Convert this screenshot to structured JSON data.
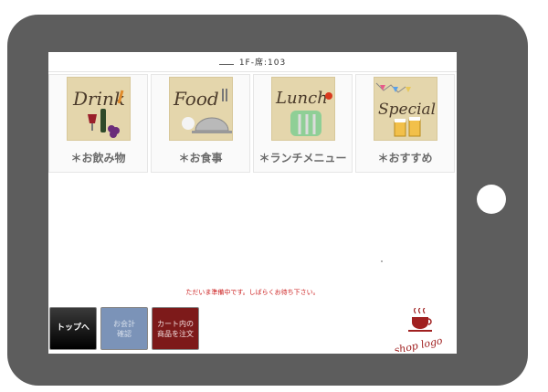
{
  "header": {
    "seat": "1F-席:103"
  },
  "categories": [
    {
      "label": "＊お飲み物",
      "image_word": "Drink",
      "icon": "drink-image"
    },
    {
      "label": "＊お食事",
      "image_word": "Food",
      "icon": "food-image"
    },
    {
      "label": "＊ランチメニュー",
      "image_word": "Lunch",
      "icon": "lunch-image"
    },
    {
      "label": "＊おすすめ",
      "image_word": "Special",
      "icon": "special-image"
    }
  ],
  "notice": "ただいま準備中です。しばらくお待ち下さい。",
  "buttons": {
    "top": "トップへ",
    "bill_line1": "お会計",
    "bill_line2": "確認",
    "order_line1": "カート内の",
    "order_line2": "商品を注文"
  },
  "logo": {
    "text": "shop logo"
  },
  "colors": {
    "frame": "#5d5d5d",
    "notice": "#cc2020",
    "bill": "#7b93b8",
    "order": "#7d1a1a"
  }
}
